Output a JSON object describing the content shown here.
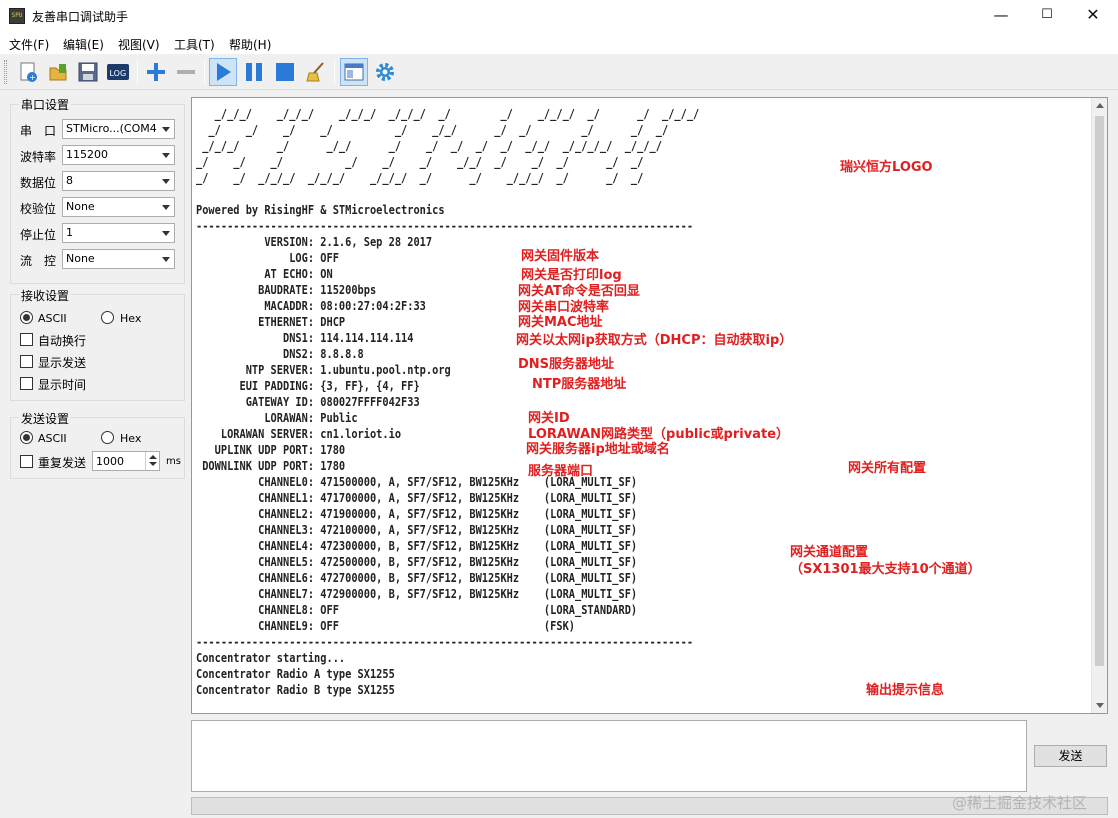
{
  "window": {
    "icon_text": "SPU",
    "title": "友善串口调试助手",
    "minimize": "—",
    "maximize": "☐",
    "close": "✕"
  },
  "menu": [
    "文件(F)",
    "编辑(E)",
    "视图(V)",
    "工具(T)",
    "帮助(H)"
  ],
  "toolbar": {
    "icons": [
      "new-connection-icon",
      "open-file-icon",
      "save-icon",
      "log-icon",
      "add-icon",
      "remove-icon",
      "play-icon",
      "pause-icon",
      "stop-icon",
      "broom-clear-icon",
      "window-layout-icon",
      "settings-gear-icon"
    ],
    "log_label": "LOG"
  },
  "serial_settings": {
    "title": "串口设置",
    "fields": [
      {
        "label": "串　口",
        "value": "STMicro...(COM4"
      },
      {
        "label": "波特率",
        "value": "115200"
      },
      {
        "label": "数据位",
        "value": "8"
      },
      {
        "label": "校验位",
        "value": "None"
      },
      {
        "label": "停止位",
        "value": "1"
      },
      {
        "label": "流　控",
        "value": "None"
      }
    ]
  },
  "receive_settings": {
    "title": "接收设置",
    "radio_ascii": "ASCII",
    "radio_hex": "Hex",
    "selected": "ASCII",
    "checkboxes": [
      "自动换行",
      "显示发送",
      "显示时间"
    ]
  },
  "send_settings": {
    "title": "发送设置",
    "radio_ascii": "ASCII",
    "radio_hex": "Hex",
    "selected": "ASCII",
    "repeat_label": "重复发送",
    "interval": "1000",
    "unit": "ms"
  },
  "receive_text": "   _/_/_/    _/_/_/    _/_/_/  _/_/_/  _/        _/    _/_/_/  _/      _/  _/_/_/\n  _/    _/    _/    _/          _/    _/_/      _/  _/        _/      _/  _/\n _/_/_/      _/      _/_/      _/    _/  _/  _/  _/  _/_/  _/_/_/_/  _/_/_/\n_/    _/    _/          _/    _/    _/    _/_/  _/    _/  _/      _/  _/\n_/    _/  _/_/_/  _/_/_/    _/_/_/  _/      _/    _/_/_/  _/      _/  _/\n\nPowered by RisingHF & STMicroelectronics\n--------------------------------------------------------------------------------\n           VERSION: 2.1.6, Sep 28 2017\n               LOG: OFF\n           AT ECHO: ON\n          BAUDRATE: 115200bps\n           MACADDR: 08:00:27:04:2F:33\n          ETHERNET: DHCP\n              DNS1: 114.114.114.114\n              DNS2: 8.8.8.8\n        NTP SERVER: 1.ubuntu.pool.ntp.org\n       EUI PADDING: {3, FF}, {4, FF}\n        GATEWAY ID: 080027FFFF042F33\n           LORAWAN: Public\n    LORAWAN SERVER: cn1.loriot.io\n   UPLINK UDP PORT: 1780\n DOWNLINK UDP PORT: 1780\n          CHANNEL0: 471500000, A, SF7/SF12, BW125KHz    (LORA_MULTI_SF)\n          CHANNEL1: 471700000, A, SF7/SF12, BW125KHz    (LORA_MULTI_SF)\n          CHANNEL2: 471900000, A, SF7/SF12, BW125KHz    (LORA_MULTI_SF)\n          CHANNEL3: 472100000, A, SF7/SF12, BW125KHz    (LORA_MULTI_SF)\n          CHANNEL4: 472300000, B, SF7/SF12, BW125KHz    (LORA_MULTI_SF)\n          CHANNEL5: 472500000, B, SF7/SF12, BW125KHz    (LORA_MULTI_SF)\n          CHANNEL6: 472700000, B, SF7/SF12, BW125KHz    (LORA_MULTI_SF)\n          CHANNEL7: 472900000, B, SF7/SF12, BW125KHz    (LORA_MULTI_SF)\n          CHANNEL8: OFF                                 (LORA_STANDARD)\n          CHANNEL9: OFF                                 (FSK)\n--------------------------------------------------------------------------------\nConcentrator starting...\nConcentrator Radio A type SX1255\nConcentrator Radio B type SX1255",
  "annotations": {
    "logo": "瑞兴恒方LOGO",
    "version": "网关固件版本",
    "log": "网关是否打印log",
    "at_echo": "网关AT命令是否回显",
    "baudrate": "网关串口波特率",
    "mac": "网关MAC地址",
    "ethernet": "网关以太网ip获取方式（DHCP：自动获取ip）",
    "dns": "DNS服务器地址",
    "ntp": "NTP服务器地址",
    "gateway_id": "网关ID",
    "lorawan_type": "LORAWAN网路类型（public或private）",
    "server": "网关服务器ip地址或域名",
    "all_config": "网关所有配置",
    "port": "服务器端口",
    "channel_config": "网关通道配置",
    "channel_note": "（SX1301最大支持10个通道）",
    "output": "输出提示信息"
  },
  "send_button": "发送",
  "watermark": "@稀土掘金技术社区"
}
